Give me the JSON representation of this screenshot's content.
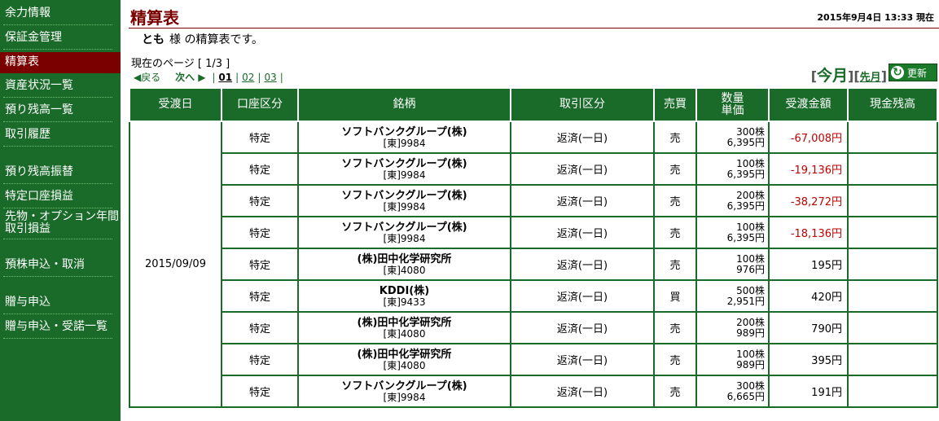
{
  "sidebar": {
    "items": [
      {
        "label": "余力情報",
        "active": false
      },
      {
        "label": "保証金管理",
        "active": false
      },
      {
        "label": "精算表",
        "active": true
      },
      {
        "label": "資産状況一覧",
        "active": false
      },
      {
        "label": "預り残高一覧",
        "active": false
      },
      {
        "label": "取引履歴",
        "active": false
      },
      {
        "label": "預り残高振替",
        "active": false
      },
      {
        "label": "特定口座損益",
        "active": false
      },
      {
        "label": "先物・オプション年間",
        "label2": "取引損益",
        "active": false
      },
      {
        "label": "預株申込・取消",
        "active": false
      },
      {
        "label": "贈与申込",
        "active": false
      },
      {
        "label": "贈与申込・受諾一覧",
        "active": false
      }
    ]
  },
  "header": {
    "title": "精算表",
    "timestamp": "2015年9月4日 13:33 現在",
    "greeting_name": "とも",
    "greeting_text": "様 の精算表です。"
  },
  "pager": {
    "page_info": "現在のページ [ 1/3 ]",
    "prev": "◀戻る",
    "next": "次へ ▶",
    "pages": [
      "01",
      "02",
      "03"
    ]
  },
  "month_nav": {
    "current": "今月",
    "previous": "先月",
    "refresh": "更新"
  },
  "table": {
    "headers": [
      "受渡日",
      "口座区分",
      "銘柄",
      "取引区分",
      "売買",
      "数量",
      "単価",
      "受渡金額",
      "現金残高"
    ],
    "date": "2015/09/09",
    "rows": [
      {
        "account": "特定",
        "name": "ソフトバンクグループ(株)",
        "code": "[東]9984",
        "type": "返済(一日)",
        "side": "売",
        "qty": "300株",
        "price": "6,395円",
        "amount": "-67,008円",
        "negative": true
      },
      {
        "account": "特定",
        "name": "ソフトバンクグループ(株)",
        "code": "[東]9984",
        "type": "返済(一日)",
        "side": "売",
        "qty": "100株",
        "price": "6,395円",
        "amount": "-19,136円",
        "negative": true
      },
      {
        "account": "特定",
        "name": "ソフトバンクグループ(株)",
        "code": "[東]9984",
        "type": "返済(一日)",
        "side": "売",
        "qty": "200株",
        "price": "6,395円",
        "amount": "-38,272円",
        "negative": true
      },
      {
        "account": "特定",
        "name": "ソフトバンクグループ(株)",
        "code": "[東]9984",
        "type": "返済(一日)",
        "side": "売",
        "qty": "100株",
        "price": "6,395円",
        "amount": "-18,136円",
        "negative": true
      },
      {
        "account": "特定",
        "name": "(株)田中化学研究所",
        "code": "[東]4080",
        "type": "返済(一日)",
        "side": "売",
        "qty": "100株",
        "price": "976円",
        "amount": "195円",
        "negative": false
      },
      {
        "account": "特定",
        "name": "KDDI(株)",
        "code": "[東]9433",
        "type": "返済(一日)",
        "side": "買",
        "qty": "500株",
        "price": "2,951円",
        "amount": "420円",
        "negative": false
      },
      {
        "account": "特定",
        "name": "(株)田中化学研究所",
        "code": "[東]4080",
        "type": "返済(一日)",
        "side": "売",
        "qty": "200株",
        "price": "989円",
        "amount": "790円",
        "negative": false
      },
      {
        "account": "特定",
        "name": "(株)田中化学研究所",
        "code": "[東]4080",
        "type": "返済(一日)",
        "side": "売",
        "qty": "100株",
        "price": "989円",
        "amount": "395円",
        "negative": false
      },
      {
        "account": "特定",
        "name": "ソフトバンクグループ(株)",
        "code": "[東]9984",
        "type": "返済(一日)",
        "side": "売",
        "qty": "300株",
        "price": "6,665円",
        "amount": "191円",
        "negative": false
      }
    ]
  },
  "colors": {
    "sidebar": "#1a6b2a",
    "active": "#7a0000",
    "negative": "#c00000"
  }
}
